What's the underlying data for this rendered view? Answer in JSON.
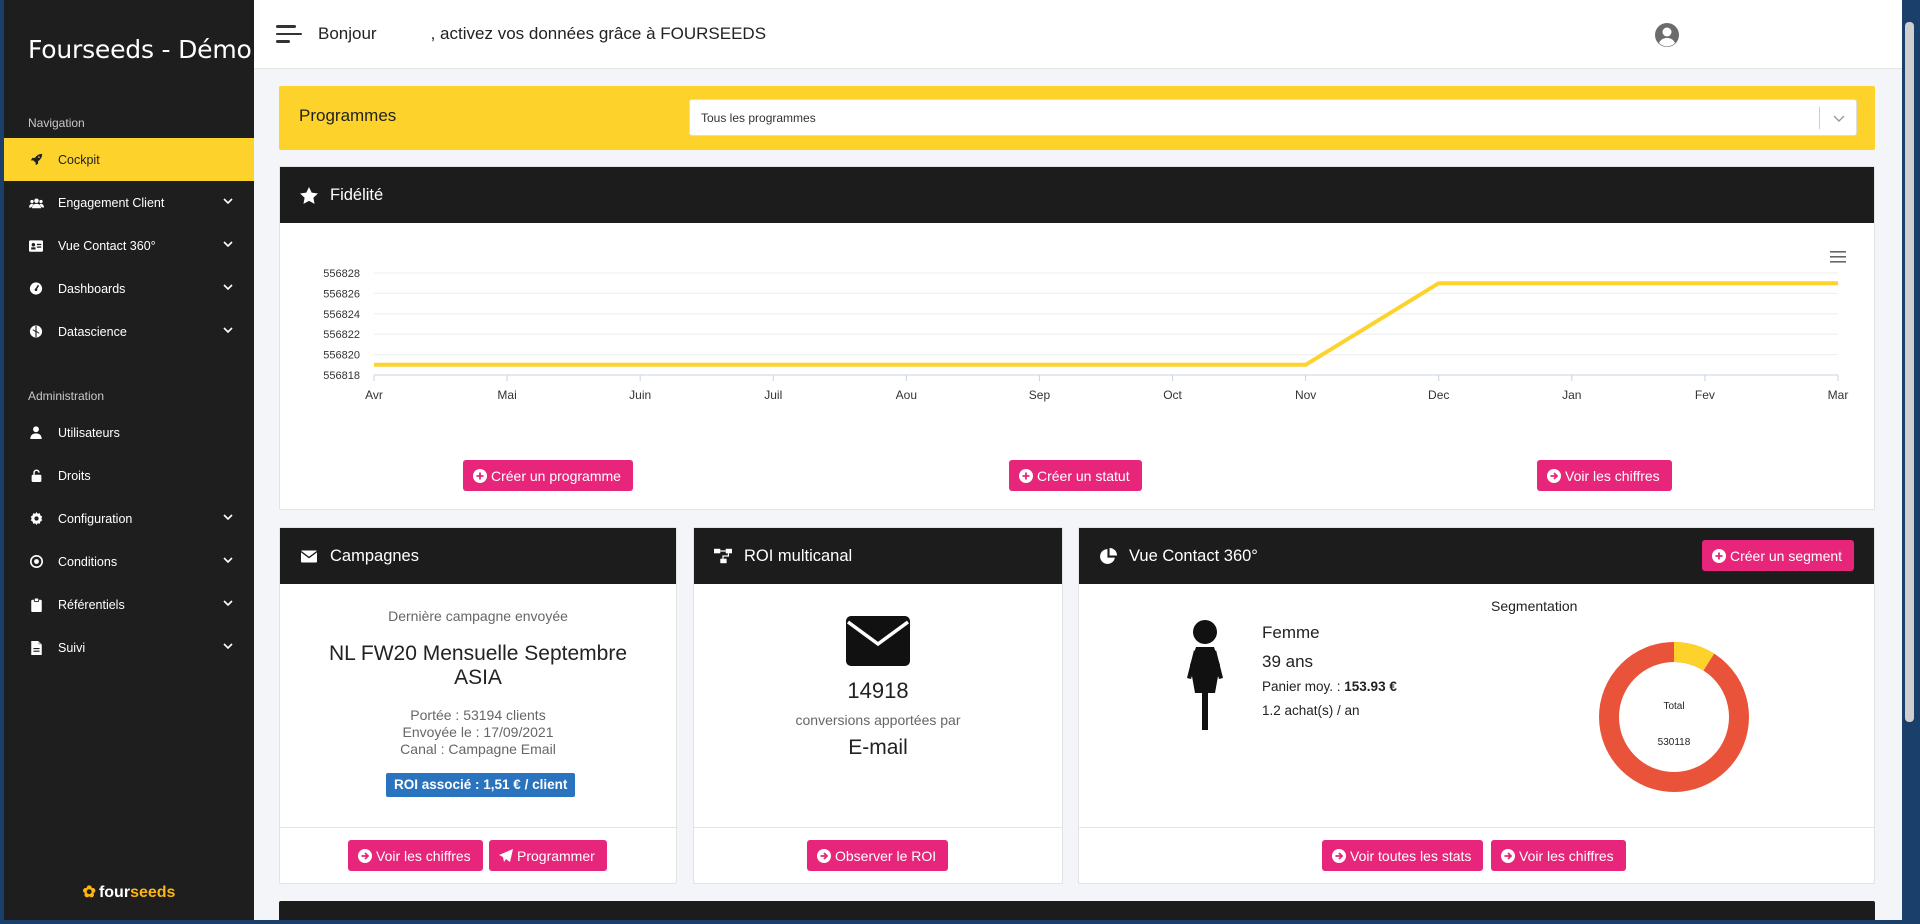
{
  "brand": "Fourseeds - Démo",
  "sidebar": {
    "nav_heading": "Navigation",
    "nav_items": [
      {
        "label": "Cockpit"
      },
      {
        "label": "Engagement Client"
      },
      {
        "label": "Vue Contact 360°"
      },
      {
        "label": "Dashboards"
      },
      {
        "label": "Datascience"
      }
    ],
    "admin_heading": "Administration",
    "admin_items": [
      {
        "label": "Utilisateurs"
      },
      {
        "label": "Droits"
      },
      {
        "label": "Configuration"
      },
      {
        "label": "Conditions"
      },
      {
        "label": "Référentiels"
      },
      {
        "label": "Suivi"
      }
    ],
    "logo_four": "four",
    "logo_seeds": "seeds"
  },
  "topbar": {
    "greeting_start": "Bonjour",
    "greeting_end": ", activez vos données grâce à FOURSEEDS"
  },
  "programmes": {
    "label": "Programmes",
    "selected": "Tous les programmes"
  },
  "fidelite": {
    "title": "Fidélité",
    "buttons": {
      "create_program": "Créer un programme",
      "create_status": "Créer un statut",
      "see_figures": "Voir les chiffres"
    }
  },
  "chart_data": {
    "type": "line",
    "categories": [
      "Avr",
      "Mai",
      "Juin",
      "Juil",
      "Aou",
      "Sep",
      "Oct",
      "Nov",
      "Dec",
      "Jan",
      "Fev",
      "Mar"
    ],
    "values": [
      556819,
      556819,
      556819,
      556819,
      556819,
      556819,
      556819,
      556819,
      556827,
      556827,
      556827,
      556827
    ],
    "yticks": [
      556818,
      556820,
      556822,
      556824,
      556826,
      556828
    ],
    "ylim": [
      556818,
      556828
    ],
    "grid": true,
    "color": "#fdd22b"
  },
  "campagnes": {
    "title": "Campagnes",
    "subtitle": "Dernière campagne envoyée",
    "name_line1": "NL FW20 Mensuelle Septembre",
    "name_line2": "ASIA",
    "reach": "Portée : 53194 clients",
    "sent": "Envoyée le : 17/09/2021",
    "channel": "Canal : Campagne Email",
    "roi_badge": "ROI associé : 1,51 € / client",
    "btn_figures": "Voir les chiffres",
    "btn_schedule": "Programmer"
  },
  "roi": {
    "title": "ROI multicanal",
    "value": "14918",
    "caption": "conversions apportées par",
    "channel": "E-mail",
    "btn": "Observer le ROI"
  },
  "contact": {
    "title": "Vue Contact 360°",
    "btn_segment": "Créer un segment",
    "segmentation": "Segmentation",
    "gender": "Femme",
    "age": "39 ans",
    "basket_label": "Panier moy. : ",
    "basket_value": "153.93 €",
    "purchases": "1.2 achat(s) / an",
    "donut_label": "Total",
    "donut_total": "530118",
    "donut_share": 0.09,
    "donut_colors": {
      "main": "#e9533a",
      "minor": "#fdd22b"
    },
    "btn_stats": "Voir toutes les stats",
    "btn_figures": "Voir les chiffres"
  },
  "colors": {
    "accent_yellow": "#fdd22b",
    "accent_pink": "#e7267b",
    "sidebar_bg": "#1e1e1e",
    "badge_blue": "#2a73be"
  }
}
